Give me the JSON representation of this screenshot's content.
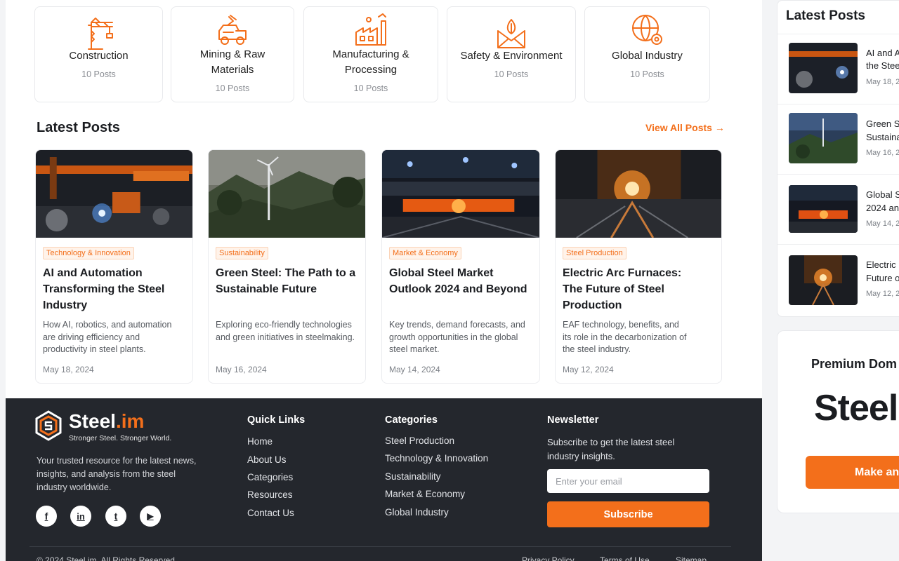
{
  "categories": [
    {
      "name": "Construction",
      "count": "10 Posts",
      "icon": "crane-icon"
    },
    {
      "name": "Mining & Raw Materials",
      "count": "10 Posts",
      "icon": "mining-truck-icon"
    },
    {
      "name": "Manufacturing & Processing",
      "count": "10 Posts",
      "icon": "factory-icon"
    },
    {
      "name": "Safety & Environment",
      "count": "10 Posts",
      "icon": "eco-envelope-icon"
    },
    {
      "name": "Global Industry",
      "count": "10 Posts",
      "icon": "globe-gear-icon"
    }
  ],
  "latest": {
    "title": "Latest Posts",
    "view_all": "View All Posts →",
    "posts": [
      {
        "tag": "Technology & Innovation",
        "title": "AI and Automation Transforming the Steel Industry",
        "desc": "How AI, robotics, and automation are driving efficiency and productivity in steel plants.",
        "date": "May 18, 2024"
      },
      {
        "tag": "Sustainability",
        "title": "Green Steel: The Path to a Sustainable Future",
        "desc": "Exploring eco-friendly technologies and green initiatives in steelmaking.",
        "date": "May 16, 2024"
      },
      {
        "tag": "Market & Economy",
        "title": "Global Steel Market Outlook 2024 and Beyond",
        "desc": "Key trends, demand forecasts, and growth opportunities in the global steel market.",
        "date": "May 14, 2024"
      },
      {
        "tag": "Steel Production",
        "title": "Electric Arc Furnaces: The Future of Steel Production",
        "desc": "EAF technology, benefits, and its role in the decarbonization of the steel industry.",
        "date": "May 12, 2024"
      }
    ]
  },
  "footer": {
    "brand_main": "Steel",
    "brand_accent": ".im",
    "tagline": "Stronger Steel. Stronger World.",
    "about": "Your trusted resource for the latest news, insights, and analysis from the steel industry worldwide.",
    "social": [
      {
        "icon": "facebook-icon",
        "glyph": "f"
      },
      {
        "icon": "linkedin-icon",
        "glyph": "in"
      },
      {
        "icon": "twitter-icon",
        "glyph": "t"
      },
      {
        "icon": "youtube-icon",
        "glyph": "▶"
      }
    ],
    "quick_links": {
      "title": "Quick Links",
      "items": [
        "Home",
        "About Us",
        "Categories",
        "Resources",
        "Contact Us"
      ]
    },
    "categories": {
      "title": "Categories",
      "items": [
        "Steel Production",
        "Technology & Innovation",
        "Sustainability",
        "Market & Economy",
        "Global Industry"
      ]
    },
    "newsletter": {
      "title": "Newsletter",
      "text": "Subscribe to get the latest steel industry insights.",
      "placeholder": "Enter your email",
      "button": "Subscribe"
    },
    "copyright": "© 2024 Steel.im. All Rights Reserved.",
    "legal": [
      "Privacy Policy",
      "Terms of Use",
      "Sitemap"
    ]
  },
  "sidebar": {
    "title": "Latest Posts",
    "items": [
      {
        "line1": "AI and A",
        "line2": "the Stee",
        "date": "May 18, 2"
      },
      {
        "line1": "Green S",
        "line2": "Sustaina",
        "date": "May 16, 2"
      },
      {
        "line1": "Global S",
        "line2": "2024 an",
        "date": "May 14, 2"
      },
      {
        "line1": "Electric",
        "line2": "Future o",
        "date": "May 12, 2"
      }
    ]
  },
  "promo": {
    "label": "Premium Dom",
    "domain": "Steel",
    "button": "Make an"
  },
  "colors": {
    "accent": "#f36f1b",
    "footer_bg": "#24272d"
  }
}
